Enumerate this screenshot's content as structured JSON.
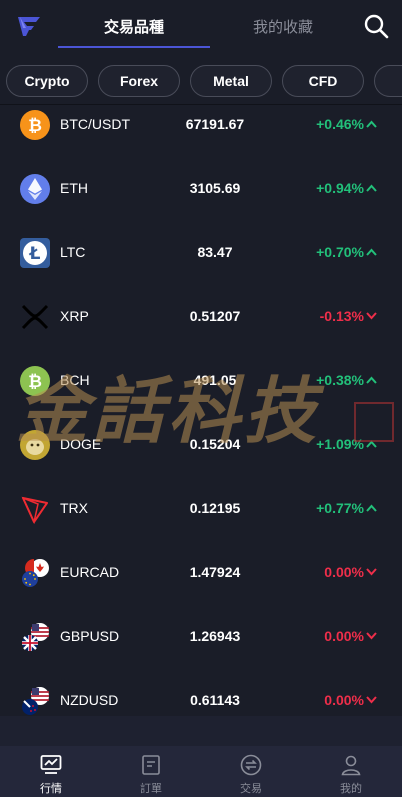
{
  "header": {
    "tabs": [
      {
        "label": "交易品種",
        "active": true
      },
      {
        "label": "我的收藏",
        "active": false
      }
    ]
  },
  "filters": [
    "Crypto",
    "Forex",
    "Metal",
    "CFD"
  ],
  "colors": {
    "up": "#22c07a",
    "down": "#ee2e4a",
    "accent": "#4b55d6"
  },
  "rows": [
    {
      "symbol": "BTC/USDT",
      "price": "67191.67",
      "change": "+0.46%",
      "dir": "up",
      "icon": "bitcoin-icon"
    },
    {
      "symbol": "ETH",
      "price": "3105.69",
      "change": "+0.94%",
      "dir": "up",
      "icon": "ethereum-icon"
    },
    {
      "symbol": "LTC",
      "price": "83.47",
      "change": "+0.70%",
      "dir": "up",
      "icon": "litecoin-icon"
    },
    {
      "symbol": "XRP",
      "price": "0.51207",
      "change": "-0.13%",
      "dir": "down",
      "icon": "xrp-icon"
    },
    {
      "symbol": "BCH",
      "price": "491.05",
      "change": "+0.38%",
      "dir": "up",
      "icon": "bitcoin-cash-icon"
    },
    {
      "symbol": "DOGE",
      "price": "0.15204",
      "change": "+1.09%",
      "dir": "up",
      "icon": "dogecoin-icon"
    },
    {
      "symbol": "TRX",
      "price": "0.12195",
      "change": "+0.77%",
      "dir": "up",
      "icon": "tron-icon"
    },
    {
      "symbol": "EURCAD",
      "price": "1.47924",
      "change": "0.00%",
      "dir": "down",
      "icon": "eurcad-flag-icon"
    },
    {
      "symbol": "GBPUSD",
      "price": "1.26943",
      "change": "0.00%",
      "dir": "down",
      "icon": "gbpusd-flag-icon"
    },
    {
      "symbol": "NZDUSD",
      "price": "0.61143",
      "change": "0.00%",
      "dir": "down",
      "icon": "nzdusd-flag-icon"
    }
  ],
  "watermark": {
    "text": "金話科技"
  },
  "nav": [
    {
      "label": "行情",
      "active": true,
      "icon": "market-chart-icon"
    },
    {
      "label": "訂單",
      "active": false,
      "icon": "orders-icon"
    },
    {
      "label": "交易",
      "active": false,
      "icon": "trade-exchange-icon"
    },
    {
      "label": "我的",
      "active": false,
      "icon": "profile-icon"
    }
  ]
}
